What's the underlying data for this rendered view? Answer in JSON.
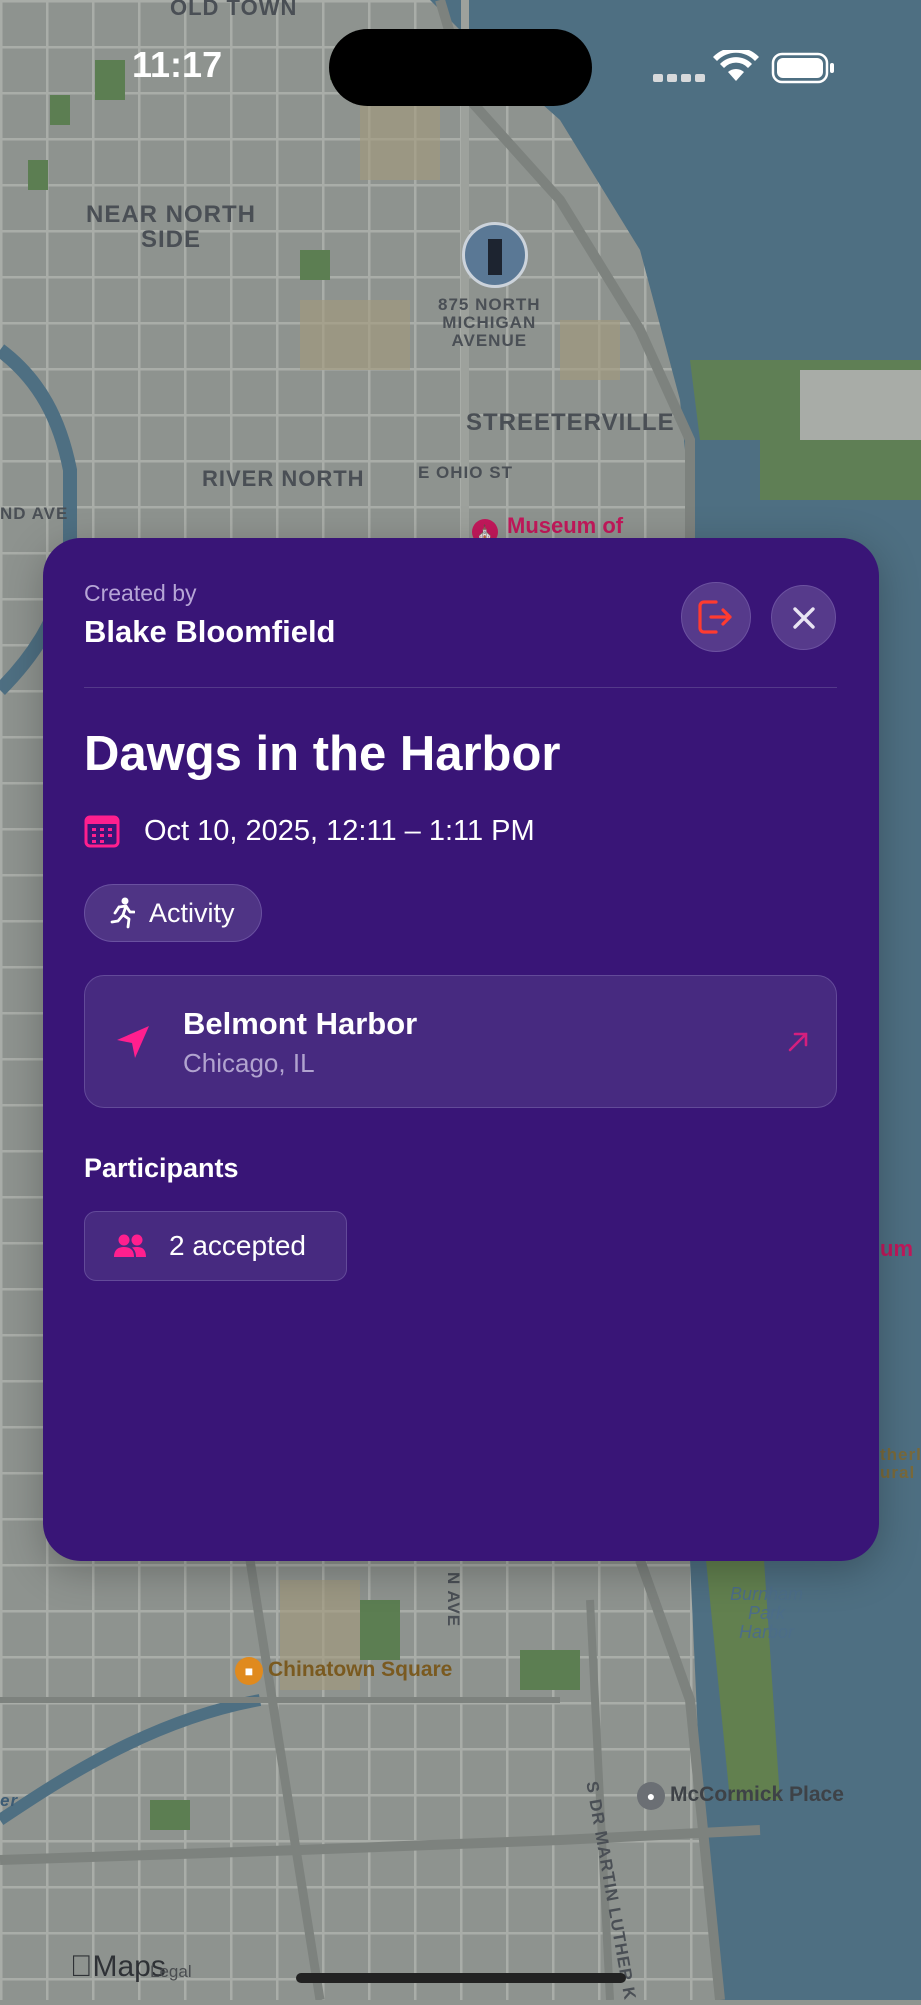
{
  "status_bar": {
    "time": "11:17"
  },
  "map": {
    "labels": {
      "old_town": "OLD TOWN",
      "near_north_side": "NEAR NORTH\nSIDE",
      "landmark_875": "875 NORTH\nMICHIGAN\nAVENUE",
      "streeterville": "STREETERVILLE",
      "river_north": "RIVER NORTH",
      "e_ohio_st": "E OHIO ST",
      "grand_ave": "ND AVE",
      "museum_of": "Museum of",
      "museum_fragment": "um",
      "shedd_fragment": "therl\nural A",
      "burnham_park_harbor": "Burnham\nPark\nHarbor",
      "chinatown_square": "Chinatown Square",
      "mccormick_place": "McCormick Place",
      "dr_martin_luther": "S DR MARTIN LUTHER K",
      "n_ave": "N AVE",
      "er_fragment": "er"
    },
    "attribution": {
      "logo": "Maps",
      "legal": "Legal"
    }
  },
  "card": {
    "created_by_label": "Created by",
    "creator_name": "Blake Bloomfield",
    "title": "Dawgs in the Harbor",
    "datetime": "Oct 10, 2025, 12:11 – 1:11 PM",
    "category": "Activity",
    "location": {
      "name": "Belmont Harbor",
      "subtitle": "Chicago, IL"
    },
    "participants_heading": "Participants",
    "participants_count": "2 accepted"
  },
  "colors": {
    "card_background": "#391577",
    "accent_pink": "#ff1f8e",
    "leave_icon_red": "#ff3b30"
  },
  "icons": {
    "leave": "leave-icon",
    "close": "close-icon",
    "calendar": "calendar-icon",
    "activity": "running-icon",
    "location": "location-arrow-icon",
    "open_external": "external-arrow-icon",
    "participants": "people-icon"
  }
}
